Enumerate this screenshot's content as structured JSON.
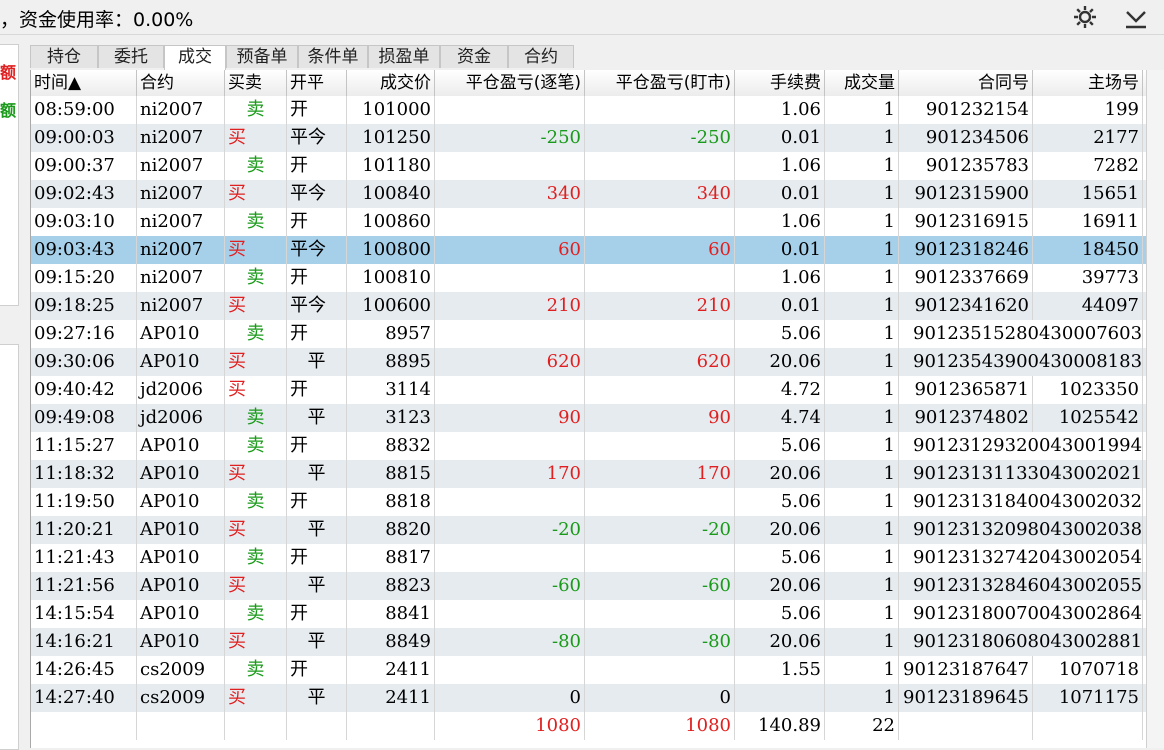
{
  "status": {
    "fund_usage_text": "，资金使用率：0.00%"
  },
  "icons": {
    "settings": "gear-icon",
    "collapse": "chevron-down-icon"
  },
  "left_panel": {
    "item1": "额",
    "item2": "额"
  },
  "tabs": [
    {
      "label": "持仓",
      "active": false
    },
    {
      "label": "委托",
      "active": false
    },
    {
      "label": "成交",
      "active": true
    },
    {
      "label": "预备单",
      "active": false
    },
    {
      "label": "条件单",
      "active": false
    },
    {
      "label": "损盈单",
      "active": false
    },
    {
      "label": "资金",
      "active": false
    },
    {
      "label": "合约",
      "active": false
    }
  ],
  "columns": [
    "时间▲",
    "合约",
    "买卖",
    "开平",
    "成交价",
    "平仓盈亏(逐笔)",
    "平仓盈亏(盯市)",
    "手续费",
    "成交量",
    "合同号",
    "主场号"
  ],
  "rows": [
    {
      "time": "08:59:00",
      "contract": "ni2007",
      "side": "卖",
      "offset": "开",
      "price": "101000",
      "pnl_trade": "",
      "pnl_mtm": "",
      "fee": "1.06",
      "qty": "1",
      "order_no": "901232154",
      "exch_no": "199"
    },
    {
      "time": "09:00:03",
      "contract": "ni2007",
      "side": "买",
      "offset": "平今",
      "price": "101250",
      "pnl_trade": "-250",
      "pnl_mtm": "-250",
      "fee": "0.01",
      "qty": "1",
      "order_no": "901234506",
      "exch_no": "2177"
    },
    {
      "time": "09:00:37",
      "contract": "ni2007",
      "side": "卖",
      "offset": "开",
      "price": "101180",
      "pnl_trade": "",
      "pnl_mtm": "",
      "fee": "1.06",
      "qty": "1",
      "order_no": "901235783",
      "exch_no": "7282"
    },
    {
      "time": "09:02:43",
      "contract": "ni2007",
      "side": "买",
      "offset": "平今",
      "price": "100840",
      "pnl_trade": "340",
      "pnl_mtm": "340",
      "fee": "0.01",
      "qty": "1",
      "order_no": "9012315900",
      "exch_no": "15651"
    },
    {
      "time": "09:03:10",
      "contract": "ni2007",
      "side": "卖",
      "offset": "开",
      "price": "100860",
      "pnl_trade": "",
      "pnl_mtm": "",
      "fee": "1.06",
      "qty": "1",
      "order_no": "9012316915",
      "exch_no": "16911"
    },
    {
      "time": "09:03:43",
      "contract": "ni2007",
      "side": "买",
      "offset": "平今",
      "price": "100800",
      "pnl_trade": "60",
      "pnl_mtm": "60",
      "fee": "0.01",
      "qty": "1",
      "order_no": "9012318246",
      "exch_no": "18450",
      "selected": true
    },
    {
      "time": "09:15:20",
      "contract": "ni2007",
      "side": "卖",
      "offset": "开",
      "price": "100810",
      "pnl_trade": "",
      "pnl_mtm": "",
      "fee": "1.06",
      "qty": "1",
      "order_no": "9012337669",
      "exch_no": "39773"
    },
    {
      "time": "09:18:25",
      "contract": "ni2007",
      "side": "买",
      "offset": "平今",
      "price": "100600",
      "pnl_trade": "210",
      "pnl_mtm": "210",
      "fee": "0.01",
      "qty": "1",
      "order_no": "9012341620",
      "exch_no": "44097"
    },
    {
      "time": "09:27:16",
      "contract": "AP010",
      "side": "卖",
      "offset": "开",
      "price": "8957",
      "pnl_trade": "",
      "pnl_mtm": "",
      "fee": "5.06",
      "qty": "1",
      "order_no": "901235152804300076037",
      "exch_no": ""
    },
    {
      "time": "09:30:06",
      "contract": "AP010",
      "side": "买",
      "offset": "平",
      "price": "8895",
      "pnl_trade": "620",
      "pnl_mtm": "620",
      "fee": "20.06",
      "qty": "1",
      "order_no": "901235439004300081833",
      "exch_no": ""
    },
    {
      "time": "09:40:42",
      "contract": "jd2006",
      "side": "买",
      "offset": "开",
      "price": "3114",
      "pnl_trade": "",
      "pnl_mtm": "",
      "fee": "4.72",
      "qty": "1",
      "order_no": "9012365871",
      "exch_no": "1023350"
    },
    {
      "time": "09:49:08",
      "contract": "jd2006",
      "side": "卖",
      "offset": "平",
      "price": "3123",
      "pnl_trade": "90",
      "pnl_mtm": "90",
      "fee": "4.74",
      "qty": "1",
      "order_no": "9012374802",
      "exch_no": "1025542"
    },
    {
      "time": "11:15:27",
      "contract": "AP010",
      "side": "卖",
      "offset": "开",
      "price": "8832",
      "pnl_trade": "",
      "pnl_mtm": "",
      "fee": "5.06",
      "qty": "1",
      "order_no": "9012312932004300199445",
      "exch_no": ""
    },
    {
      "time": "11:18:32",
      "contract": "AP010",
      "side": "买",
      "offset": "平",
      "price": "8815",
      "pnl_trade": "170",
      "pnl_mtm": "170",
      "fee": "20.06",
      "qty": "1",
      "order_no": "9012313113304300202100",
      "exch_no": ""
    },
    {
      "time": "11:19:50",
      "contract": "AP010",
      "side": "卖",
      "offset": "开",
      "price": "8818",
      "pnl_trade": "",
      "pnl_mtm": "",
      "fee": "5.06",
      "qty": "1",
      "order_no": "9012313184004300203262",
      "exch_no": ""
    },
    {
      "time": "11:20:21",
      "contract": "AP010",
      "side": "买",
      "offset": "平",
      "price": "8820",
      "pnl_trade": "-20",
      "pnl_mtm": "-20",
      "fee": "20.06",
      "qty": "1",
      "order_no": "9012313209804300203878",
      "exch_no": ""
    },
    {
      "time": "11:21:43",
      "contract": "AP010",
      "side": "卖",
      "offset": "开",
      "price": "8817",
      "pnl_trade": "",
      "pnl_mtm": "",
      "fee": "5.06",
      "qty": "1",
      "order_no": "9012313274204300205422",
      "exch_no": ""
    },
    {
      "time": "11:21:56",
      "contract": "AP010",
      "side": "买",
      "offset": "平",
      "price": "8823",
      "pnl_trade": "-60",
      "pnl_mtm": "-60",
      "fee": "20.06",
      "qty": "1",
      "order_no": "9012313284604300205582",
      "exch_no": ""
    },
    {
      "time": "14:15:54",
      "contract": "AP010",
      "side": "卖",
      "offset": "开",
      "price": "8841",
      "pnl_trade": "",
      "pnl_mtm": "",
      "fee": "5.06",
      "qty": "1",
      "order_no": "9012318007004300286464",
      "exch_no": ""
    },
    {
      "time": "14:16:21",
      "contract": "AP010",
      "side": "买",
      "offset": "平",
      "price": "8849",
      "pnl_trade": "-80",
      "pnl_mtm": "-80",
      "fee": "20.06",
      "qty": "1",
      "order_no": "9012318060804300288181",
      "exch_no": ""
    },
    {
      "time": "14:26:45",
      "contract": "cs2009",
      "side": "卖",
      "offset": "开",
      "price": "2411",
      "pnl_trade": "",
      "pnl_mtm": "",
      "fee": "1.55",
      "qty": "1",
      "order_no": "90123187647",
      "exch_no": "1070718"
    },
    {
      "time": "14:27:40",
      "contract": "cs2009",
      "side": "买",
      "offset": "平",
      "price": "2411",
      "pnl_trade": "0",
      "pnl_mtm": "0",
      "fee": "",
      "qty": "1",
      "order_no": "90123189645",
      "exch_no": "1071175"
    }
  ],
  "totals": {
    "pnl_trade": "1080",
    "pnl_mtm": "1080",
    "fee": "140.89",
    "qty": "22"
  },
  "colors": {
    "buy": "#e02020",
    "sell": "#1a9a1a",
    "selected_row": "#a6d0ea",
    "alt_row": "#e6ebf0"
  }
}
